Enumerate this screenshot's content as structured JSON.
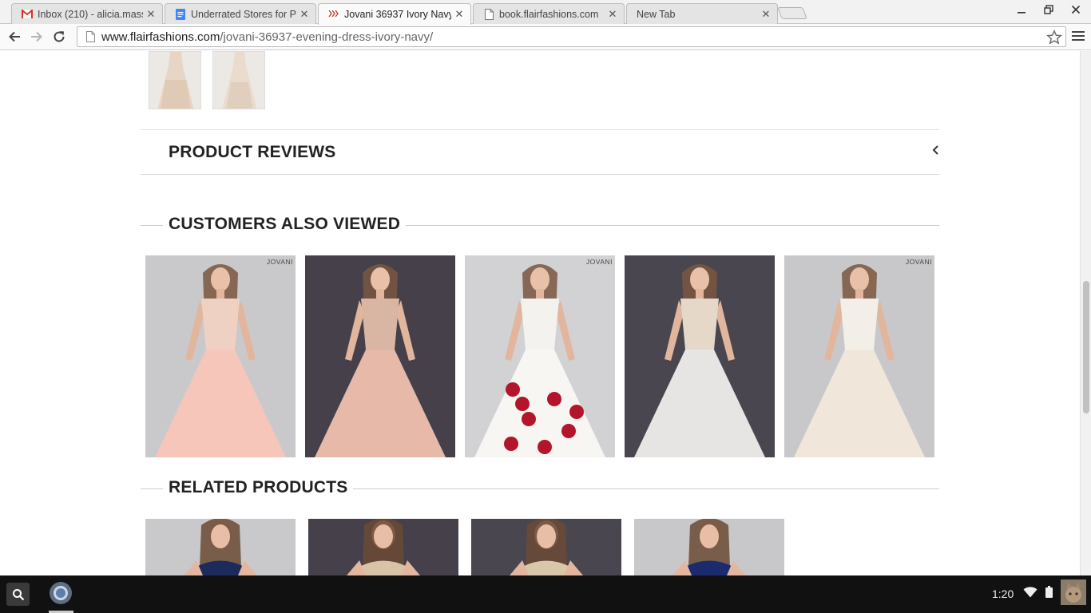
{
  "browser": {
    "tabs": [
      {
        "title": "Inbox (210) - alicia.mass",
        "favicon": "gmail-icon",
        "active": false
      },
      {
        "title": "Underrated Stores for Pr",
        "favicon": "docs-icon",
        "active": false
      },
      {
        "title": "Jovani 36937 Ivory Navy",
        "favicon": "flair-icon",
        "active": true
      },
      {
        "title": "book.flairfashions.com",
        "favicon": "page-icon",
        "active": false
      },
      {
        "title": "New Tab",
        "favicon": "",
        "active": false
      }
    ],
    "url_host": "www.flairfashions.com",
    "url_path": "/jovani-36937-evening-dress-ivory-navy/"
  },
  "product_reviews": {
    "title": "PRODUCT REVIEWS"
  },
  "customers_also_viewed": {
    "title": "CUSTOMERS ALSO VIEWED",
    "items": [
      {
        "brand": "JOVANI",
        "bg": "#c9c9cb",
        "dress": "#f5c6b9",
        "bodice": "#efd1c4"
      },
      {
        "brand": "",
        "bg": "#45404a",
        "dress": "#e6b9a9",
        "bodice": "#d9b5a3"
      },
      {
        "brand": "JOVANI",
        "bg": "#d2d2d4",
        "dress": "#f8f6f3",
        "bodice": "#f4f2ef",
        "accent": "#b3162a"
      },
      {
        "brand": "",
        "bg": "#4a4650",
        "dress": "#e7e5e4",
        "bodice": "#e5d8c8"
      },
      {
        "brand": "JOVANI",
        "bg": "#c8c8ca",
        "dress": "#f0e6da",
        "bodice": "#f3efe8"
      }
    ]
  },
  "related_products": {
    "title": "RELATED PRODUCTS",
    "items": [
      {
        "bg": "#c9c9cb",
        "dress": "#1d2a5c"
      },
      {
        "bg": "#45404a",
        "dress": "#d7c4a7"
      },
      {
        "bg": "#4a4650",
        "dress": "#d8c7a8"
      },
      {
        "bg": "#c8c8ca",
        "dress": "#1c2b6e"
      }
    ]
  },
  "system": {
    "time": "1:20"
  }
}
